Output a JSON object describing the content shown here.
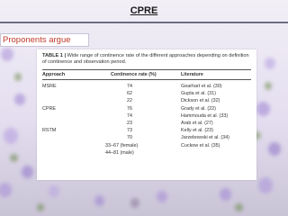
{
  "slide": {
    "title": "CPRE",
    "subtitle": "Proponents argue"
  },
  "table": {
    "caption_bold": "TABLE 1 |",
    "caption_text": "Wide range of continence rate of the different approaches depending on definition of continence and observation period.",
    "headers": [
      "Approach",
      "Continence rate (%)",
      "Literature"
    ],
    "rows": [
      {
        "approach": "MSRE",
        "rate": "74",
        "literature": "Gearhart et al. (30)"
      },
      {
        "approach": "",
        "rate": "62",
        "literature": "Gupta et al. (31)"
      },
      {
        "approach": "",
        "rate": "22",
        "literature": "Dickson et al. (32)"
      },
      {
        "approach": "CPRE",
        "rate": "76",
        "literature": "Grady et al. (22)"
      },
      {
        "approach": "",
        "rate": "74",
        "literature": "Hammouda et al. (33)"
      },
      {
        "approach": "",
        "rate": "23",
        "literature": "Arab et al. (27)"
      },
      {
        "approach": "RSTM",
        "rate": "73",
        "literature": "Kelly et al. (23)"
      },
      {
        "approach": "",
        "rate": "70",
        "literature": "Jarzebowski et al. (34)"
      },
      {
        "approach": "",
        "rate": "33–67 (female)",
        "literature": "Cuckow et al. (35)"
      },
      {
        "approach": "",
        "rate": "44–81 (male)",
        "literature": ""
      }
    ]
  },
  "colors": {
    "subtitle_text": "#c0392b",
    "title_rule": "#6b6f80",
    "background": "#eeeaf3"
  }
}
